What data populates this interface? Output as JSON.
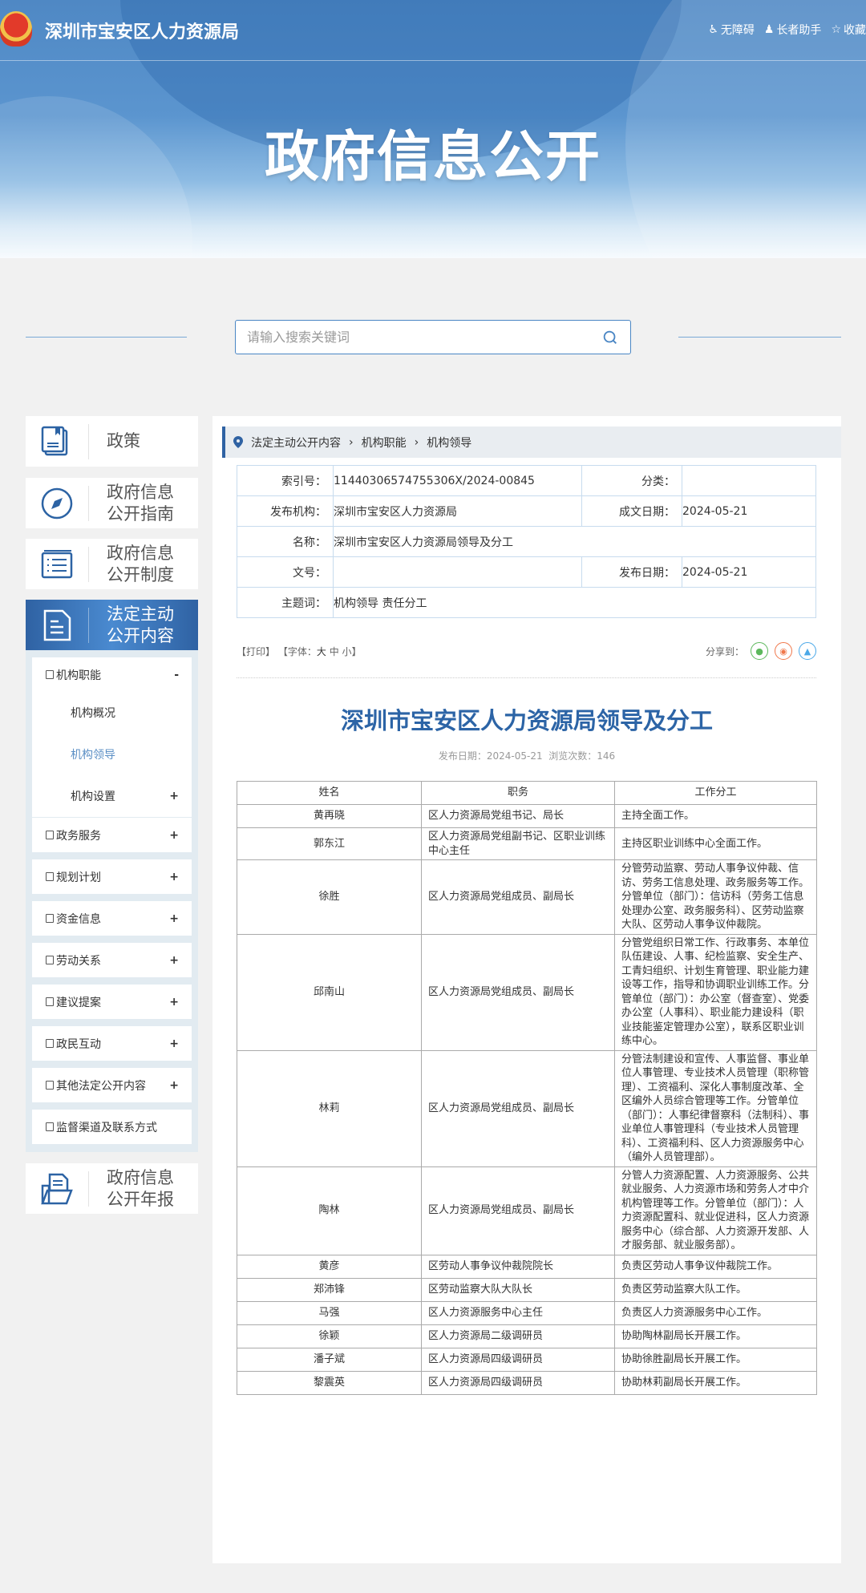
{
  "header": {
    "site_name": "深圳市宝安区人力资源局",
    "tools": [
      {
        "icon": "wheelchair-icon",
        "label": "无障碍"
      },
      {
        "icon": "elder-icon",
        "label": "长者助手"
      },
      {
        "icon": "star-icon",
        "label": "收藏"
      }
    ],
    "hero_title": "政府信息公开"
  },
  "search": {
    "placeholder": "请输入搜索关键词"
  },
  "sidebar": {
    "cards": [
      {
        "label": "政策",
        "icon": "book-icon"
      },
      {
        "label": "政府信息公开指南",
        "icon": "compass-icon"
      },
      {
        "label": "政府信息公开制度",
        "icon": "list-icon"
      },
      {
        "label": "法定主动公开内容",
        "icon": "document-icon"
      },
      {
        "label": "政府信息公开年报",
        "icon": "folder-icon"
      }
    ],
    "submenu": [
      {
        "label": "机构职能",
        "toggle": "-",
        "children": [
          {
            "label": "机构概况"
          },
          {
            "label": "机构领导"
          },
          {
            "label": "机构设置",
            "toggle": "+"
          }
        ]
      },
      {
        "label": "政务服务",
        "toggle": "+"
      },
      {
        "label": "规划计划",
        "toggle": "+"
      },
      {
        "label": "资金信息",
        "toggle": "+"
      },
      {
        "label": "劳动关系",
        "toggle": "+"
      },
      {
        "label": "建议提案",
        "toggle": "+"
      },
      {
        "label": "政民互动",
        "toggle": "+"
      },
      {
        "label": "其他法定公开内容",
        "toggle": "+"
      },
      {
        "label": "监督渠道及联系方式"
      }
    ]
  },
  "breadcrumb": [
    "法定主动公开内容",
    "机构职能",
    "机构领导"
  ],
  "meta": {
    "index_label": "索引号：",
    "index": "11440306574755306X/2024-00845",
    "category_label": "分类：",
    "category": "",
    "publisher_label": "发布机构：",
    "publisher": "深圳市宝安区人力资源局",
    "written_label": "成文日期：",
    "written": "2024-05-21",
    "name_label": "名称：",
    "name": "深圳市宝安区人力资源局领导及分工",
    "doc_no_label": "文号：",
    "doc_no": "",
    "pub_label": "发布日期：",
    "pub": "2024-05-21",
    "keywords_label": "主题词：",
    "keywords": "机构领导 责任分工"
  },
  "toolbar": {
    "print": "【打印】",
    "font_prefix": "【字体：",
    "font_large": "大",
    "font_medium": "中",
    "font_small": "小",
    "font_suffix": "】",
    "share_label": "分享到："
  },
  "article": {
    "title": "深圳市宝安区人力资源局领导及分工",
    "pub_info": "发布日期：2024-05-21  浏览次数：146"
  },
  "leaders": {
    "headers": [
      "姓名",
      "职务",
      "工作分工"
    ],
    "rows": [
      [
        "黄再晓",
        "区人力资源局党组书记、局长",
        "主持全面工作。"
      ],
      [
        "郭东江",
        "区人力资源局党组副书记、区职业训练中心主任",
        "主持区职业训练中心全面工作。"
      ],
      [
        "徐胜",
        "区人力资源局党组成员、副局长",
        "分管劳动监察、劳动人事争议仲裁、信访、劳务工信息处理、政务服务等工作。分管单位（部门）：信访科（劳务工信息处理办公室、政务服务科）、区劳动监察大队、区劳动人事争议仲裁院。"
      ],
      [
        "邱南山",
        "区人力资源局党组成员、副局长",
        "分管党组织日常工作、行政事务、本单位队伍建设、人事、纪检监察、安全生产、工青妇组织、计划生育管理、职业能力建设等工作，指导和协调职业训练工作。分管单位（部门）：办公室（督查室）、党委办公室（人事科）、职业能力建设科（职业技能鉴定管理办公室），联系区职业训练中心。"
      ],
      [
        "林莉",
        "区人力资源局党组成员、副局长",
        "分管法制建设和宣传、人事监督、事业单位人事管理、专业技术人员管理（职称管理）、工资福利、深化人事制度改革、全区编外人员综合管理等工作。分管单位（部门）：人事纪律督察科（法制科）、事业单位人事管理科（专业技术人员管理科）、工资福利科、区人力资源服务中心（编外人员管理部）。"
      ],
      [
        "陶林",
        "区人力资源局党组成员、副局长",
        "分管人力资源配置、人力资源服务、公共就业服务、人力资源市场和劳务人才中介机构管理等工作。分管单位（部门）：人力资源配置科、就业促进科，区人力资源服务中心（综合部、人力资源开发部、人才服务部、就业服务部）。"
      ],
      [
        "黄彦",
        "区劳动人事争议仲裁院院长",
        "负责区劳动人事争议仲裁院工作。"
      ],
      [
        "郑沛锋",
        "区劳动监察大队大队长",
        "负责区劳动监察大队工作。"
      ],
      [
        "马强",
        "区人力资源服务中心主任",
        "负责区人力资源服务中心工作。"
      ],
      [
        "徐颖",
        "区人力资源局二级调研员",
        "协助陶林副局长开展工作。"
      ],
      [
        "潘子斌",
        "区人力资源局四级调研员",
        "协助徐胜副局长开展工作。"
      ],
      [
        "黎震英",
        "区人力资源局四级调研员",
        "协助林莉副局长开展工作。"
      ]
    ]
  },
  "colors": {
    "brand": "#2f62a3",
    "title": "#2c64a6",
    "wechat": "#5cb85c",
    "weibo": "#f0774a",
    "qq": "#4aa8e8"
  }
}
